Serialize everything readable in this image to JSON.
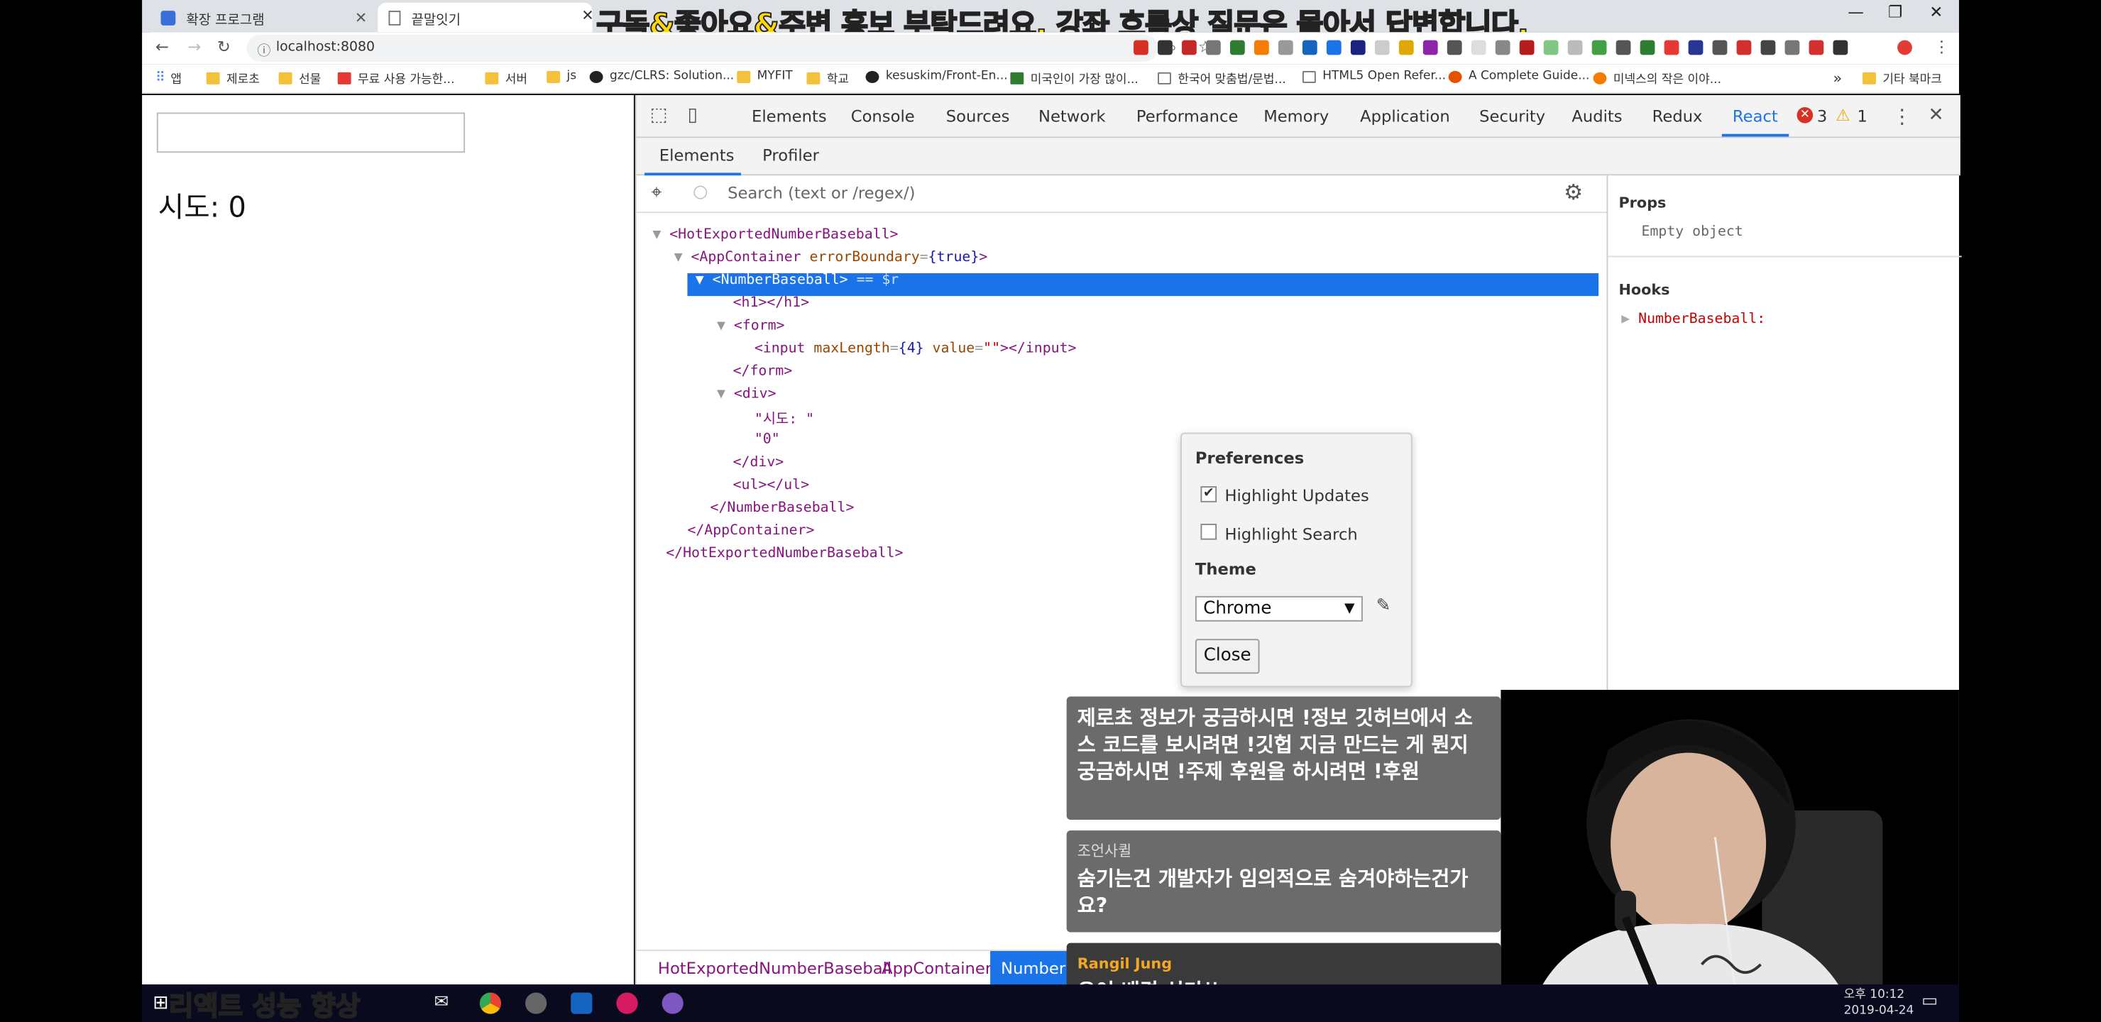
{
  "tabs": [
    {
      "label": "확장 프로그램",
      "active": false
    },
    {
      "label": "끝말잇기",
      "active": true
    }
  ],
  "banner": "구독&좋아요&주변 홍보 부탁드려요. 강좌 흐름상 질문은 몰아서 답변합니다.",
  "address": {
    "url": "localhost:8080"
  },
  "bookmarks": [
    "앱",
    "제로초",
    "선물",
    "무료 사용 가능한...",
    "서버",
    "js",
    "gzc/CLRS: Solution...",
    "MYFIT",
    "학교",
    "kesuskim/Front-En...",
    "미국인이 가장 많이...",
    "한국어 맞춤법/문법...",
    "HTML5 Open Refer...",
    "A Complete Guide...",
    "미넥스의 작은 이야...",
    "»",
    "기타 북마크"
  ],
  "page": {
    "input_value": "",
    "count_label": "시도: 0"
  },
  "devtools": {
    "tabs": [
      "Elements",
      "Console",
      "Sources",
      "Network",
      "Performance",
      "Memory",
      "Application",
      "Security",
      "Audits",
      "Redux",
      "React"
    ],
    "active_tab": "React",
    "errors": "3",
    "warnings": "1",
    "subtabs": [
      "Elements",
      "Profiler"
    ],
    "search_placeholder": "Search (text or /regex/)",
    "tree": {
      "l1": "<HotExportedNumberBaseball>",
      "l2_tag": "<AppContainer",
      "l2_attr": "errorBoundary",
      "l2_val": "{true}",
      "l2_end": ">",
      "l3": "<NumberBaseball>",
      "l3_suffix": "== $r",
      "l4": "<h1></h1>",
      "l5": "<form>",
      "l6_tag": "<input",
      "l6_attr1": "maxLength",
      "l6_val1": "{4}",
      "l6_attr2": "value",
      "l6_val2": "\"\"",
      "l6_end": "></input>",
      "l7": "</form>",
      "l8": "<div>",
      "l9": "\"시도: \"",
      "l10": "\"0\"",
      "l11": "</div>",
      "l12": "<ul></ul>",
      "l13": "</NumberBaseball>",
      "l14": "</AppContainer>",
      "l15": "</HotExportedNumberBaseball>"
    },
    "sidebar": {
      "props_title": "Props",
      "props_value": "Empty object",
      "hooks_title": "Hooks",
      "hook_item": "NumberBaseball:"
    },
    "breadcrumbs": [
      "HotExportedNumberBaseball",
      "AppContainer",
      "NumberBaseball"
    ]
  },
  "preferences": {
    "title": "Preferences",
    "highlight_updates": "Highlight Updates",
    "highlight_updates_checked": true,
    "highlight_search": "Highlight Search",
    "highlight_search_checked": false,
    "theme_label": "Theme",
    "theme_value": "Chrome",
    "close_label": "Close"
  },
  "chat": [
    {
      "user": "",
      "text": "제로초 정보가 궁금하시면 !정보 깃허브에서 소스 코드를 보시려면 !깃헙 지금 만드는 게 뭔지 궁금하시면 !주제 후원을 하시려면 !후원"
    },
    {
      "user": "조언사퀼",
      "text": "숨기는건 개발자가 임의적으로 숨겨야하는건가요?"
    },
    {
      "user": "Rangil Jung",
      "text": "우어 배경 신기쓰~~~"
    }
  ],
  "taskbar": {
    "caption": "리액트 성능 향상",
    "time": "오후 10:12",
    "date": "2019-04-24"
  }
}
